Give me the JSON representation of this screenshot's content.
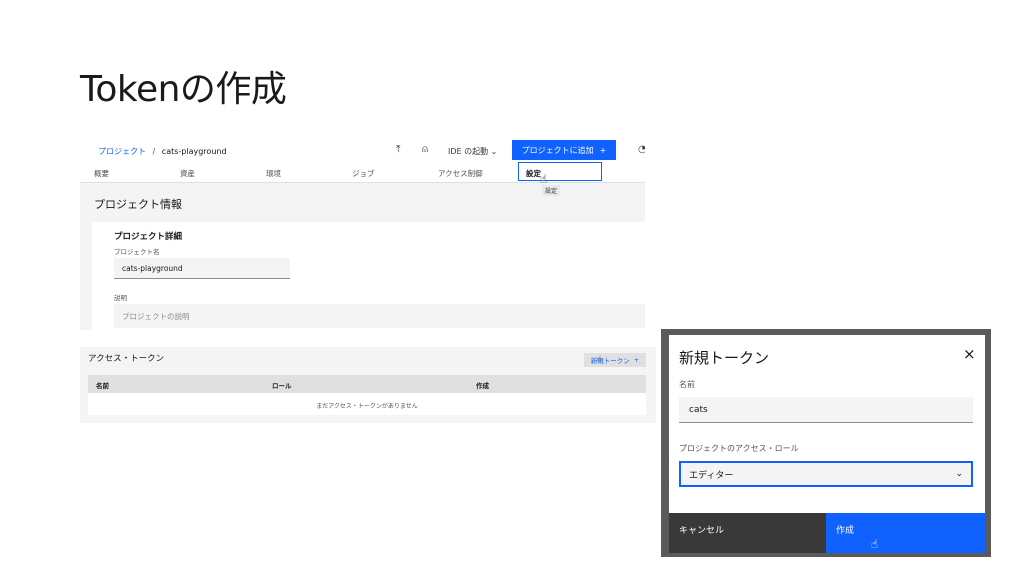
{
  "slide": {
    "title": "Tokenの作成"
  },
  "project_screen": {
    "breadcrumb_root": "プロジェクト",
    "breadcrumb_sep": "/",
    "breadcrumb_current": "cats-playground",
    "ide_label": "IDE の起動",
    "add_button": "プロジェクトに追加",
    "plus": "+",
    "tabs": [
      "概要",
      "資産",
      "環境",
      "ジョブ",
      "アクセス制御",
      "設定"
    ],
    "tooltip": "設定",
    "section_title": "プロジェクト情報",
    "details_title": "プロジェクト詳細",
    "name_label": "プロジェクト名",
    "name_value": "cats-playground",
    "desc_label": "説明",
    "desc_placeholder": "プロジェクトの説明"
  },
  "tokens_screen": {
    "title": "アクセス・トークン",
    "new_button": "新規トークン",
    "plus": "+",
    "columns": [
      "名前",
      "ロール",
      "作成"
    ],
    "empty_message": "まだアクセス・トークンがありません"
  },
  "modal": {
    "title": "新規トークン",
    "close": "×",
    "name_label": "名前",
    "name_value": "cats",
    "role_label": "プロジェクトのアクセス・ロール",
    "role_value": "エディター",
    "cancel": "キャンセル",
    "create": "作成"
  },
  "colors": {
    "accent": "#0f62fe",
    "dark_button": "#393939"
  }
}
